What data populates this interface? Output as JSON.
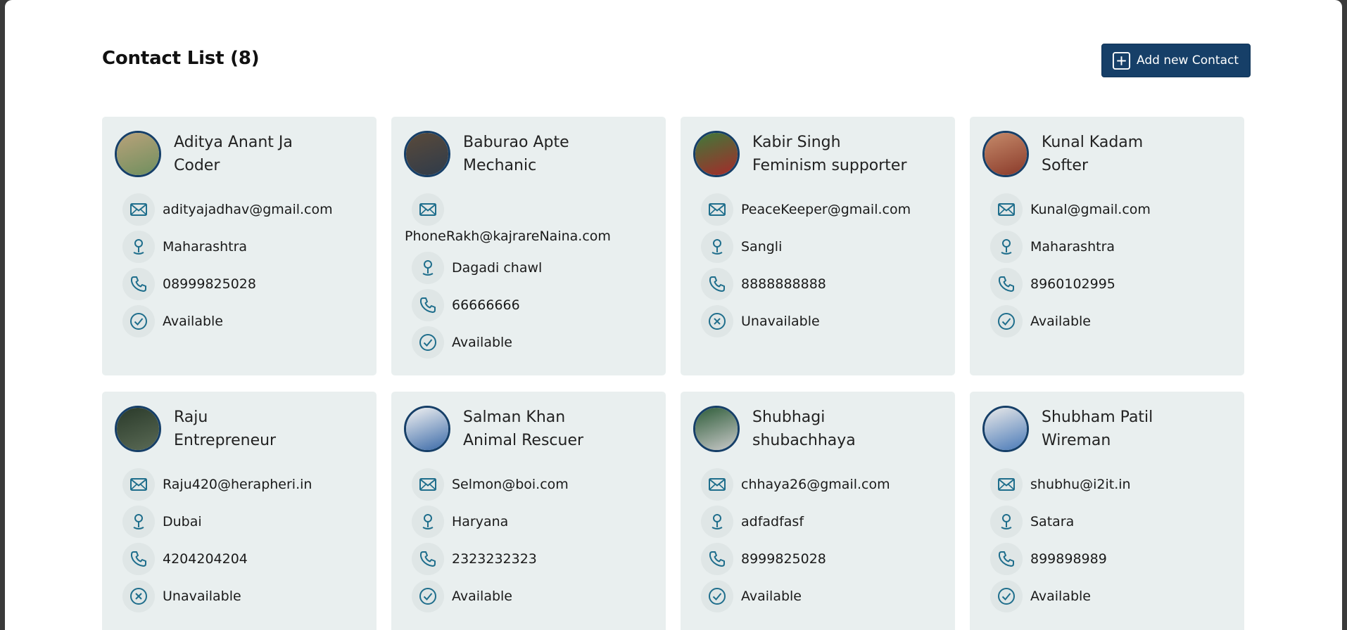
{
  "header": {
    "title": "Contact List (8)",
    "add_button_label": "Add new Contact"
  },
  "colors": {
    "accent": "#163f68",
    "icon": "#1f6e8c",
    "card_bg": "#e9efef",
    "icon_bg": "#dfe6e6"
  },
  "contacts": [
    {
      "name": "Aditya Anant Ja",
      "role": "Coder",
      "email": "adityajadhav@gmail.com",
      "location": "Maharashtra",
      "phone": "08999825028",
      "status": "Available"
    },
    {
      "name": "Baburao Apte",
      "role": "Mechanic",
      "email": "PhoneRakh@kajrareNaina.com",
      "location": "Dagadi chawl",
      "phone": "66666666",
      "status": "Available"
    },
    {
      "name": "Kabir Singh",
      "role": "Feminism supporter",
      "email": "PeaceKeeper@gmail.com",
      "location": "Sangli",
      "phone": "8888888888",
      "status": "Unavailable"
    },
    {
      "name": "Kunal Kadam",
      "role": "Softer",
      "email": "Kunal@gmail.com",
      "location": "Maharashtra",
      "phone": "8960102995",
      "status": "Available"
    },
    {
      "name": "Raju",
      "role": "Entrepreneur",
      "email": "Raju420@herapheri.in",
      "location": "Dubai",
      "phone": "4204204204",
      "status": "Unavailable"
    },
    {
      "name": "Salman Khan",
      "role": "Animal Rescuer",
      "email": "Selmon@boi.com",
      "location": "Haryana",
      "phone": "2323232323",
      "status": "Available"
    },
    {
      "name": "Shubhagi",
      "role": "shubachhaya",
      "email": "chhaya26@gmail.com",
      "location": "adfadfasf",
      "phone": "8999825028",
      "status": "Available"
    },
    {
      "name": "Shubham Patil",
      "role": "Wireman",
      "email": "shubhu@i2it.in",
      "location": "Satara",
      "phone": "899898989",
      "status": "Available"
    }
  ]
}
